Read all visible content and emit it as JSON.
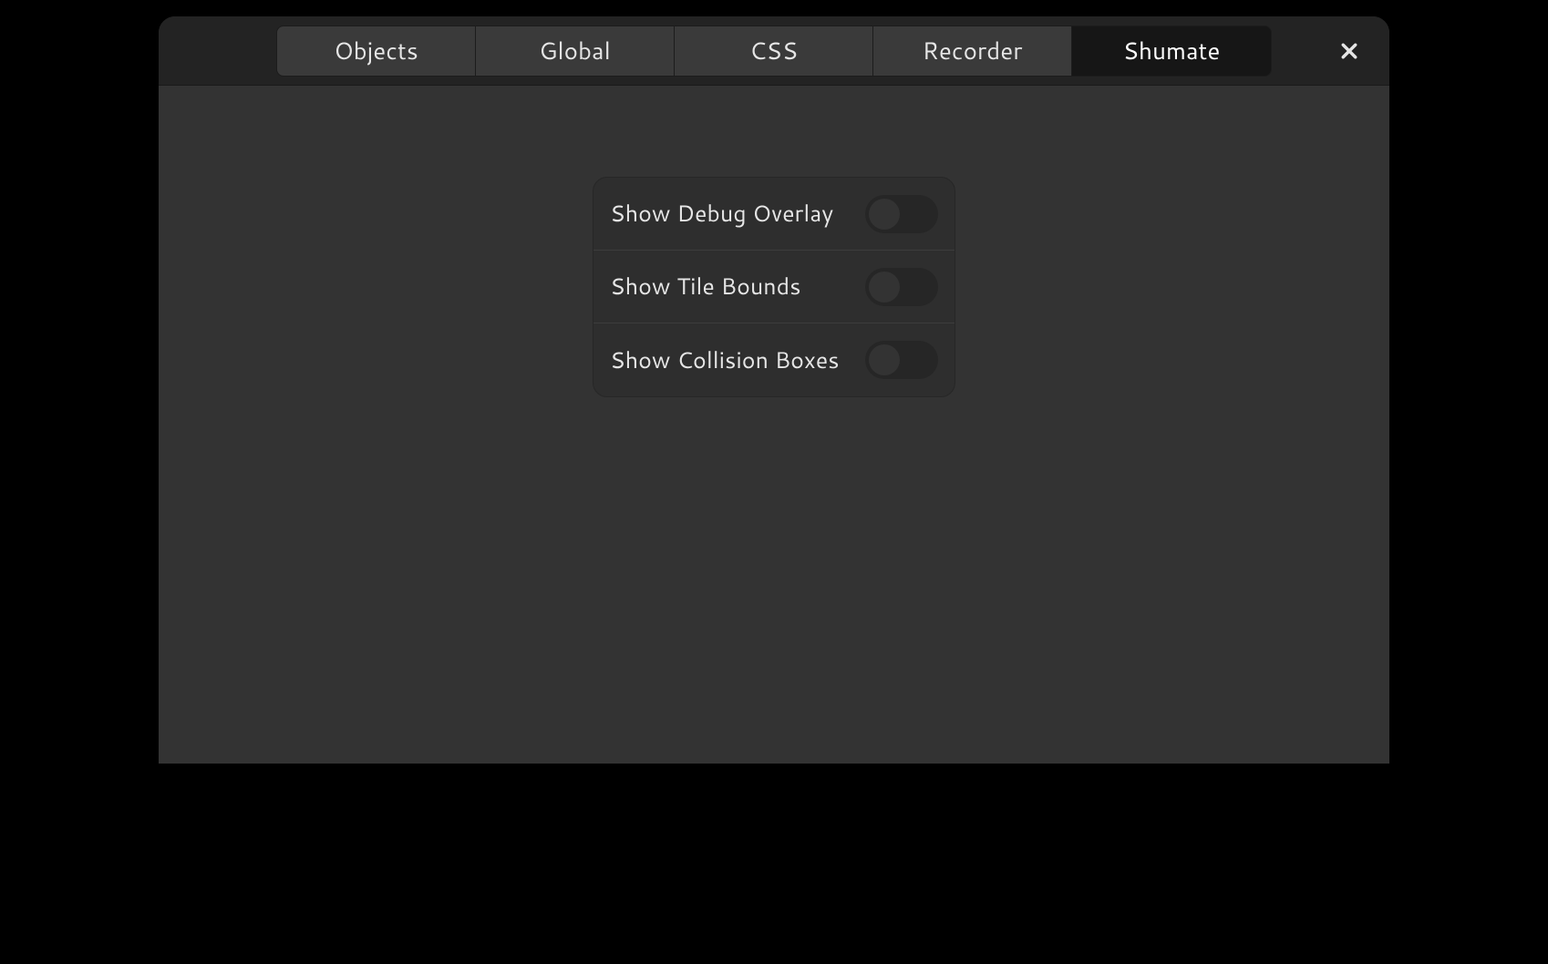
{
  "tabs": [
    {
      "label": "Objects",
      "active": false
    },
    {
      "label": "Global",
      "active": false
    },
    {
      "label": "CSS",
      "active": false
    },
    {
      "label": "Recorder",
      "active": false
    },
    {
      "label": "Shumate",
      "active": true
    }
  ],
  "settings": [
    {
      "label": "Show Debug Overlay",
      "enabled": false
    },
    {
      "label": "Show Tile Bounds",
      "enabled": false
    },
    {
      "label": "Show Collision Boxes",
      "enabled": false
    }
  ]
}
